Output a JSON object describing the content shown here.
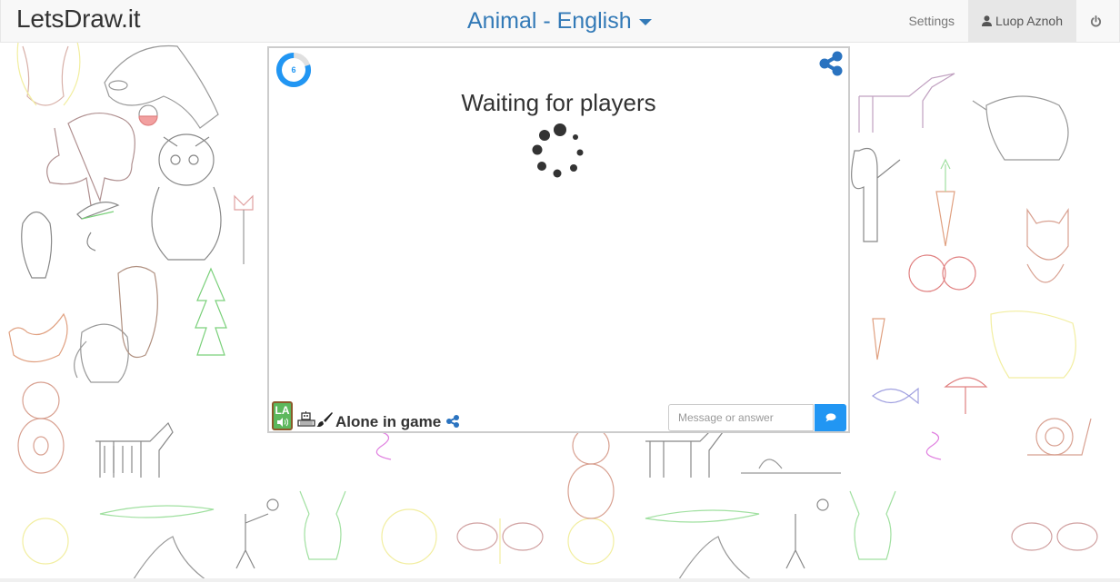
{
  "navbar": {
    "brand": "LetsDraw.it",
    "category": "Animal - English",
    "links": {
      "settings": "Settings",
      "user": "Luop Aznoh"
    },
    "icons": {
      "user": "user-icon",
      "power": "power-icon",
      "caret": "caret-down-icon"
    }
  },
  "game": {
    "timer": {
      "value": "6",
      "progress_fraction": 0.8,
      "color": "#2196f3"
    },
    "status_title": "Waiting for players",
    "share_icon": "share-icon",
    "bottom": {
      "language_badge": "LA",
      "player_status": "Alone in game",
      "message_placeholder": "Message or answer",
      "send_icon": "chat-bubble-icon"
    }
  },
  "colors": {
    "accent": "#2196f3",
    "link": "#337ab7",
    "badge_green": "#5cb85c",
    "badge_border": "#8b5a2b"
  }
}
